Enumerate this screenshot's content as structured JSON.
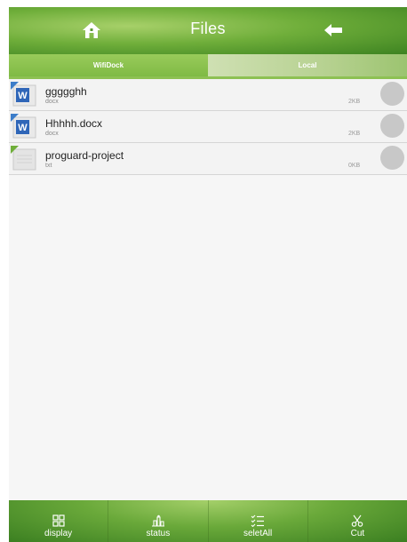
{
  "header": {
    "title": "Files",
    "home_icon": "home-icon",
    "back_icon": "back-arrow-icon"
  },
  "tabs": [
    {
      "label": "WifiDock",
      "active": true
    },
    {
      "label": "Local",
      "active": false
    }
  ],
  "files": [
    {
      "name": "ggggghh",
      "type": "docx",
      "size": "2KB",
      "icon": "word-doc-icon"
    },
    {
      "name": "Hhhhh.docx",
      "type": "docx",
      "size": "2KB",
      "icon": "word-doc-icon"
    },
    {
      "name": "proguard-project",
      "type": "txt",
      "size": "0KB",
      "icon": "text-file-icon"
    }
  ],
  "toolbar": {
    "display_label": "display",
    "status_label": "status",
    "selectall_label": "seletAll",
    "cut_label": "Cut"
  },
  "colors": {
    "accent_green": "#7fba45",
    "dark_green": "#3d8321"
  }
}
